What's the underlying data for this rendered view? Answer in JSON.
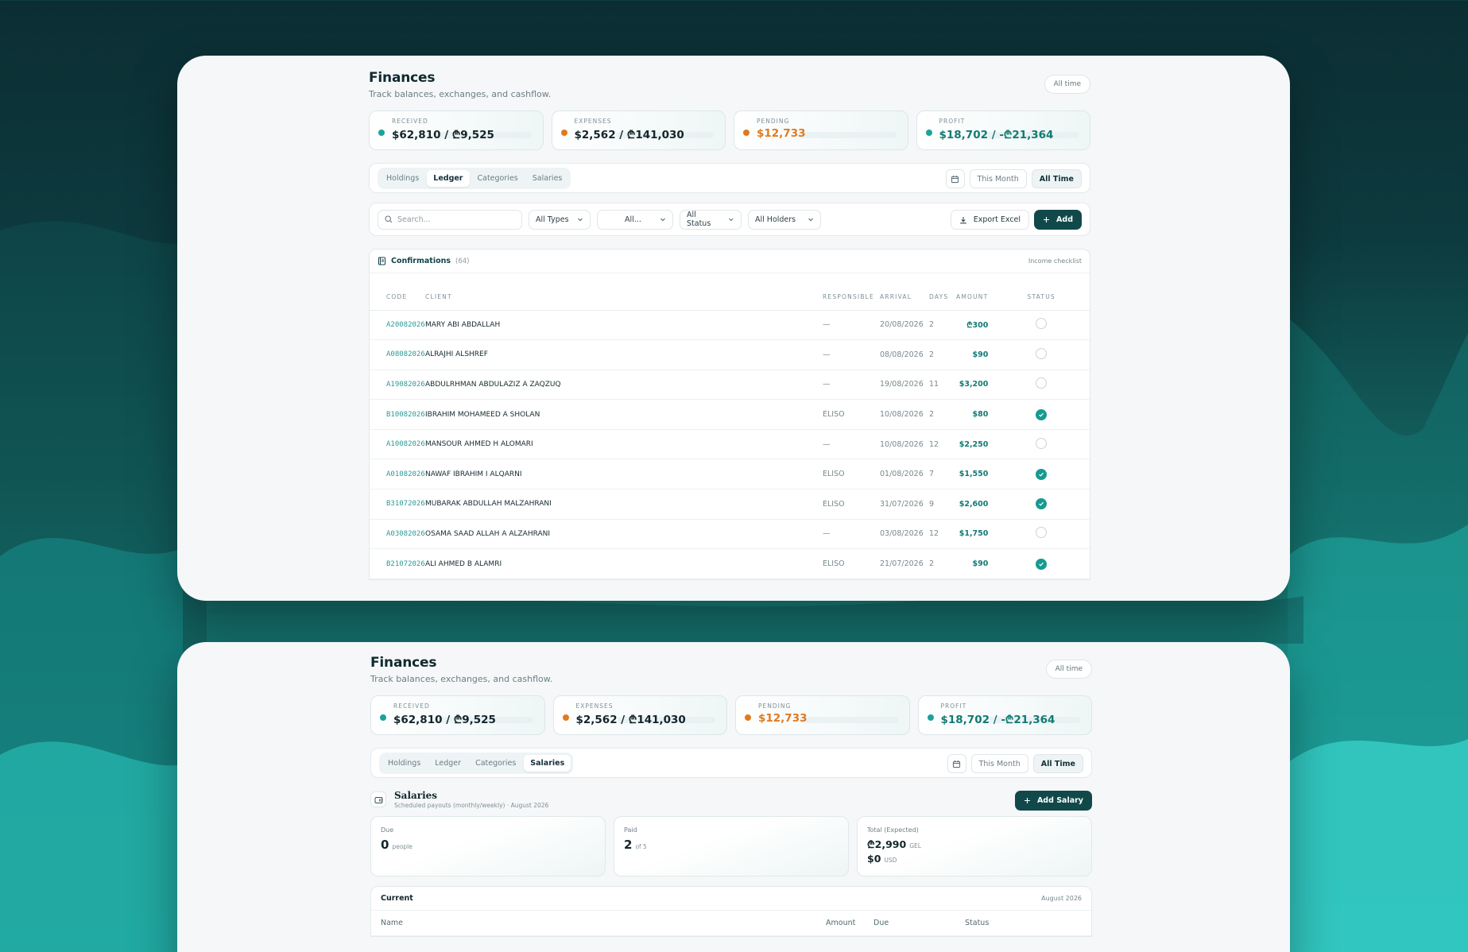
{
  "screens": [
    {
      "title": "Finances",
      "subtitle": "Track balances, exchanges, and cashflow.",
      "range_pill": "All time",
      "stats": [
        {
          "label": "RECEIVED",
          "value": "$62,810 / ₾9,525",
          "dot": "#1aa39a",
          "color": "#13252b"
        },
        {
          "label": "EXPENSES",
          "value": "$2,562 / ₾141,030",
          "dot": "#e07a1f",
          "color": "#13252b"
        },
        {
          "label": "PENDING",
          "value": "$12,733",
          "dot": "#e07a1f",
          "color": "#e07a1f"
        },
        {
          "label": "PROFIT",
          "value": "$18,702 / -₾21,364",
          "dot": "#1aa39a",
          "color": "#127a74"
        }
      ],
      "tabs": [
        "Holdings",
        "Ledger",
        "Categories",
        "Salaries"
      ],
      "active_tab": 1,
      "range_buttons": [
        "This Month",
        "All Time"
      ]
    },
    {
      "title": "Finances",
      "subtitle": "Track balances, exchanges, and cashflow.",
      "range_pill": "All time",
      "stats": [
        {
          "label": "RECEIVED",
          "value": "$62,810 / ₾9,525"
        },
        {
          "label": "EXPENSES",
          "value": "$2,562 / ₾141,030"
        },
        {
          "label": "PENDING",
          "value": "$12,733"
        },
        {
          "label": "PROFIT",
          "value": "$18,702 / -₾21,364"
        }
      ],
      "tabs": [
        "Holdings",
        "Ledger",
        "Categories",
        "Salaries"
      ],
      "active_tab": 3,
      "range_buttons": [
        "This Month",
        "All Time"
      ]
    }
  ],
  "filters": {
    "search_placeholder": "Search...",
    "types": "All Types",
    "all": "All...",
    "status": "All Status",
    "holders": "All Holders",
    "export": "Export Excel",
    "add": "Add"
  },
  "confirmations": {
    "title": "Confirmations",
    "count": "(64)",
    "link": "Income checklist",
    "columns": [
      "CODE",
      "CLIENT",
      "RESPONSIBLE",
      "ARRIVAL",
      "DAYS",
      "AMOUNT",
      "STATUS"
    ],
    "rows": [
      {
        "code": "A20082026",
        "client": "MARY ABI ABDALLAH",
        "responsible": "—",
        "arrival": "20/08/2026",
        "days": "2",
        "amount": "₾300",
        "done": false
      },
      {
        "code": "A08082026",
        "client": "ALRAJHI ALSHREF",
        "responsible": "—",
        "arrival": "08/08/2026",
        "days": "2",
        "amount": "$90",
        "done": false
      },
      {
        "code": "A19082026",
        "client": "ABDULRHMAN ABDULAZIZ A ZAQZUQ",
        "responsible": "—",
        "arrival": "19/08/2026",
        "days": "11",
        "amount": "$3,200",
        "done": false
      },
      {
        "code": "B10082026",
        "client": "IBRAHIM MOHAMEED A SHOLAN",
        "responsible": "ELISO",
        "arrival": "10/08/2026",
        "days": "2",
        "amount": "$80",
        "done": true
      },
      {
        "code": "A10082026",
        "client": "MANSOUR AHMED H ALOMARI",
        "responsible": "—",
        "arrival": "10/08/2026",
        "days": "12",
        "amount": "$2,250",
        "done": false
      },
      {
        "code": "A01082026",
        "client": "NAWAF IBRAHIM I ALQARNI",
        "responsible": "ELISO",
        "arrival": "01/08/2026",
        "days": "7",
        "amount": "$1,550",
        "done": true
      },
      {
        "code": "B31072026",
        "client": "MUBARAK ABDULLAH MALZAHRANI",
        "responsible": "ELISO",
        "arrival": "31/07/2026",
        "days": "9",
        "amount": "$2,600",
        "done": true
      },
      {
        "code": "A03082026",
        "client": "OSAMA SAAD ALLAH A ALZAHRANI",
        "responsible": "—",
        "arrival": "03/08/2026",
        "days": "12",
        "amount": "$1,750",
        "done": false
      },
      {
        "code": "B21072026",
        "client": "ALI AHMED B ALAMRI",
        "responsible": "ELISO",
        "arrival": "21/07/2026",
        "days": "2",
        "amount": "$90",
        "done": true
      }
    ]
  },
  "salaries": {
    "title": "Salaries",
    "subtitle": "Scheduled payouts (monthly/weekly) · August 2026",
    "add_button": "Add Salary",
    "due_label": "Due",
    "due_value": "0",
    "due_unit": "people",
    "paid_label": "Paid",
    "paid_value": "2",
    "paid_unit": "of 5",
    "total_label": "Total (Expected)",
    "total_gel": "₾2,990",
    "total_gel_unit": "GEL",
    "total_usd": "$0",
    "total_usd_unit": "USD",
    "current_title": "Current",
    "current_month": "August 2026",
    "columns": [
      "Name",
      "Amount",
      "Due",
      "Status"
    ]
  },
  "colors": {
    "accent": "#11494a",
    "teal": "#1aa39a",
    "orange": "#e07a1f"
  },
  "icons": [
    "search-icon",
    "calendar-icon",
    "download-icon",
    "plus-icon",
    "chevron-down-icon",
    "book-icon",
    "check-icon",
    "wallet-icon"
  ]
}
